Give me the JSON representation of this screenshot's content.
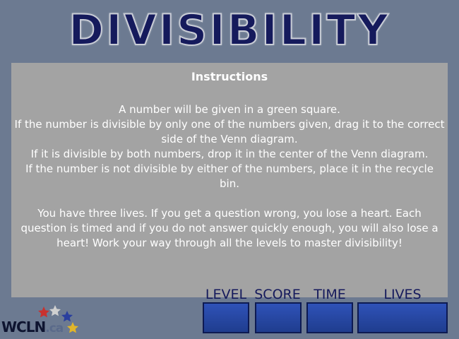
{
  "title": "DIVISIBILITY",
  "instructions": {
    "heading": "Instructions",
    "lines": [
      "A number will be given in a green square.",
      "If the number is divisible by only one of the numbers given, drag it to the correct side of the Venn diagram.",
      "If it is divisible by both numbers, drop it in the center of the Venn diagram.",
      "If the number is not divisible by either of the numbers, place it in the recycle bin."
    ],
    "paragraph2": "You have three lives. If you get a question wrong, you lose a heart. Each question is timed and if you do not answer quickly enough, you will also lose a heart! Work your way through all the levels to master divisibility!"
  },
  "hud": {
    "level_label": "LEVEL",
    "score_label": "SCORE",
    "time_label": "TIME",
    "lives_label": "LIVES"
  },
  "logo": {
    "text": "WCLN",
    "ext": ".ca",
    "star_colors": [
      "#c8312f",
      "#d0d0d0",
      "#2a3f9e",
      "#e0b52a"
    ]
  },
  "colors": {
    "background": "#6c7a91",
    "panel": "#a3a3a3",
    "title": "#151a5c",
    "hud_box": "#2f52b8"
  }
}
